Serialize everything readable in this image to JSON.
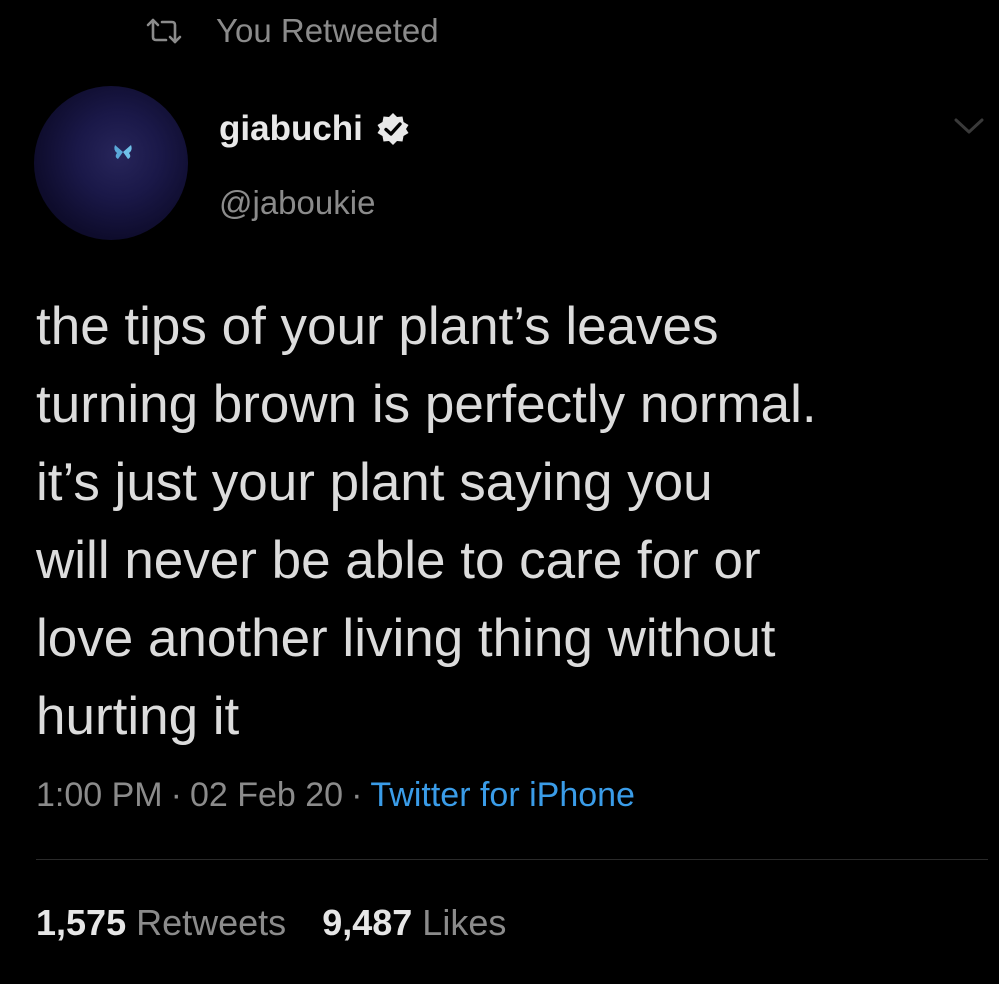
{
  "header": {
    "retweet_label": "You Retweeted"
  },
  "author": {
    "display_name": "giabuchi",
    "handle": "@jaboukie",
    "verified": true
  },
  "tweet": {
    "text": "the tips of your plant’s leaves\nturning  brown is perfectly normal.\nit’s just your plant saying you\nwill never be able to care for or\nlove another living thing without\nhurting it",
    "time": "1:00 PM",
    "date": "02 Feb 20",
    "source": "Twitter for iPhone",
    "separator": "·"
  },
  "stats": {
    "retweets_count": "1,575",
    "retweets_label": "Retweets",
    "likes_count": "9,487",
    "likes_label": "Likes"
  },
  "icons": {
    "retweet": "retweet-icon",
    "verified": "verified-badge-icon",
    "menu": "chevron-down-icon",
    "avatar_graphic": "butterfly-icon"
  },
  "colors": {
    "background": "#000000",
    "text": "#dcdcdc",
    "muted": "#8b8b8b",
    "link": "#3a9ce8"
  }
}
